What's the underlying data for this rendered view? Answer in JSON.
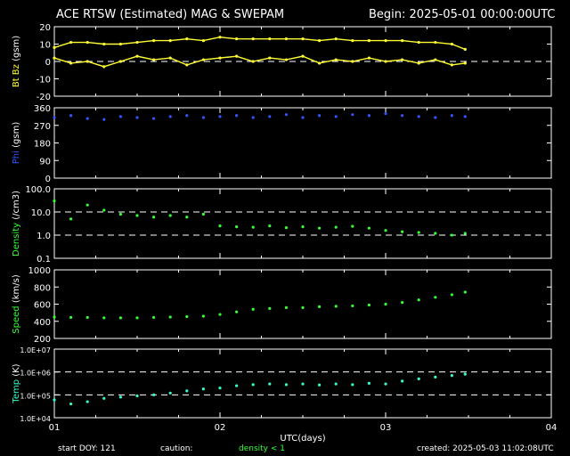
{
  "header": {
    "title": "ACE RTSW (Estimated) MAG & SWEPAM",
    "begin": "Begin: 2025-05-01 00:00:00UTC"
  },
  "footer": {
    "start_doy": "start DOY: 121",
    "caution": "caution:",
    "density_note": "density < 1",
    "created": "created: 2025-05-03 11:02:08UTC"
  },
  "colors": {
    "background": "#000000",
    "bt_bz": "#ffff33",
    "phi": "#3355ff",
    "density": "#33ff33",
    "speed": "#33ff33",
    "temp": "#33ffcc",
    "axes": "#ffffff"
  },
  "chart_data": [
    {
      "type": "line",
      "title": "ACE RTSW (Estimated) MAG & SWEPAM",
      "ylabel_parts": [
        {
          "text": "Bt",
          "color": "#ffff33"
        },
        {
          "text": " Bz",
          "color": "#ffff33"
        },
        {
          "text": " (gsm)",
          "color": "#ffffff"
        }
      ],
      "ylim": [
        -20,
        20
      ],
      "yticks": [
        "20",
        "10",
        "0",
        "-10",
        "-20"
      ],
      "ytick_values": [
        20,
        10,
        0,
        -10,
        -20
      ],
      "dashed_lines": [
        0
      ],
      "xlim": [
        1,
        4
      ],
      "series": [
        {
          "name": "Bt",
          "color": "#ffff33",
          "x": [
            1.0,
            1.1,
            1.2,
            1.3,
            1.4,
            1.5,
            1.6,
            1.7,
            1.8,
            1.9,
            2.0,
            2.1,
            2.2,
            2.3,
            2.4,
            2.5,
            2.6,
            2.7,
            2.8,
            2.9,
            3.0,
            3.1,
            3.2,
            3.3,
            3.4,
            3.48
          ],
          "y": [
            8,
            11,
            11,
            10,
            10,
            11,
            12,
            12,
            13,
            12,
            14,
            13,
            13,
            13,
            13,
            13,
            12,
            13,
            12,
            12,
            12,
            12,
            11,
            11,
            10,
            7
          ]
        },
        {
          "name": "Bz",
          "color": "#ffff33",
          "x": [
            1.0,
            1.1,
            1.2,
            1.3,
            1.4,
            1.5,
            1.6,
            1.7,
            1.8,
            1.9,
            2.0,
            2.1,
            2.2,
            2.3,
            2.4,
            2.5,
            2.6,
            2.7,
            2.8,
            2.9,
            3.0,
            3.1,
            3.2,
            3.3,
            3.4,
            3.48
          ],
          "y": [
            2,
            -1,
            0,
            -3,
            0,
            3,
            1,
            2,
            -2,
            1,
            2,
            3,
            0,
            2,
            1,
            3,
            -1,
            1,
            0,
            2,
            0,
            1,
            -1,
            1,
            -2,
            -1
          ]
        }
      ]
    },
    {
      "type": "scatter",
      "ylabel_parts": [
        {
          "text": "Phi",
          "color": "#3355ff"
        },
        {
          "text": " (gsm)",
          "color": "#ffffff"
        }
      ],
      "ylim": [
        0,
        360
      ],
      "yticks": [
        "360",
        "270",
        "180",
        "90",
        "0"
      ],
      "ytick_values": [
        360,
        270,
        180,
        90,
        0
      ],
      "dashed_lines": [],
      "xlim": [
        1,
        4
      ],
      "series": [
        {
          "name": "Phi",
          "color": "#3355ff",
          "x": [
            1.0,
            1.1,
            1.2,
            1.3,
            1.4,
            1.5,
            1.6,
            1.7,
            1.8,
            1.9,
            2.0,
            2.1,
            2.2,
            2.3,
            2.4,
            2.5,
            2.6,
            2.7,
            2.8,
            2.9,
            3.0,
            3.1,
            3.2,
            3.3,
            3.4,
            3.48
          ],
          "y": [
            310,
            320,
            305,
            300,
            315,
            310,
            305,
            315,
            320,
            310,
            315,
            320,
            310,
            315,
            325,
            310,
            320,
            315,
            325,
            320,
            330,
            320,
            315,
            310,
            320,
            315
          ]
        }
      ]
    },
    {
      "type": "scatter",
      "ylabel_parts": [
        {
          "text": "Density",
          "color": "#33ff33"
        },
        {
          "text": " (/cm3)",
          "color": "#ffffff"
        }
      ],
      "scale": "log",
      "ylim": [
        0.1,
        100
      ],
      "yticks": [
        "100.0",
        "10.0",
        "1.0",
        "0.1"
      ],
      "ytick_values": [
        100,
        10,
        1,
        0.1
      ],
      "dashed_lines": [
        10,
        1
      ],
      "xlim": [
        1,
        4
      ],
      "series": [
        {
          "name": "Density",
          "color": "#33ff33",
          "x": [
            1.0,
            1.1,
            1.2,
            1.3,
            1.4,
            1.5,
            1.6,
            1.7,
            1.8,
            1.9,
            2.0,
            2.1,
            2.2,
            2.3,
            2.4,
            2.5,
            2.6,
            2.7,
            2.8,
            2.9,
            3.0,
            3.1,
            3.2,
            3.3,
            3.4,
            3.48
          ],
          "y": [
            30,
            5,
            20,
            12,
            8,
            7,
            6,
            7,
            6,
            8,
            2.5,
            2.3,
            2.2,
            2.5,
            2.1,
            2.3,
            2.0,
            2.2,
            2.4,
            2.0,
            1.6,
            1.4,
            1.3,
            1.2,
            1.0,
            1.2
          ]
        }
      ]
    },
    {
      "type": "scatter",
      "ylabel_parts": [
        {
          "text": "Speed",
          "color": "#33ff33"
        },
        {
          "text": " (km/s)",
          "color": "#ffffff"
        }
      ],
      "ylim": [
        200,
        1000
      ],
      "yticks": [
        "1000",
        "800",
        "600",
        "400",
        "200"
      ],
      "ytick_values": [
        1000,
        800,
        600,
        400,
        200
      ],
      "dashed_lines": [],
      "xlim": [
        1,
        4
      ],
      "series": [
        {
          "name": "Speed",
          "color": "#33ff33",
          "x": [
            1.0,
            1.1,
            1.2,
            1.3,
            1.4,
            1.5,
            1.6,
            1.7,
            1.8,
            1.9,
            2.0,
            2.1,
            2.2,
            2.3,
            2.4,
            2.5,
            2.6,
            2.7,
            2.8,
            2.9,
            3.0,
            3.1,
            3.2,
            3.3,
            3.4,
            3.48
          ],
          "y": [
            450,
            445,
            445,
            440,
            440,
            440,
            445,
            450,
            455,
            460,
            480,
            510,
            540,
            550,
            560,
            560,
            570,
            575,
            580,
            590,
            600,
            620,
            650,
            680,
            710,
            740
          ]
        }
      ]
    },
    {
      "type": "scatter",
      "ylabel_parts": [
        {
          "text": "Temp",
          "color": "#33ffcc"
        },
        {
          "text": " (K)",
          "color": "#ffffff"
        }
      ],
      "scale": "log",
      "ylim": [
        10000,
        10000000
      ],
      "yticks": [
        "1.0E+07",
        "1.0E+06",
        "1.0E+05",
        "1.0E+04"
      ],
      "ytick_values": [
        10000000,
        1000000,
        100000,
        10000
      ],
      "dashed_lines": [
        1000000,
        100000
      ],
      "xlim": [
        1,
        4
      ],
      "xlabel": "UTC(days)",
      "xticks": [
        "01",
        "02",
        "03",
        "04"
      ],
      "xtick_values": [
        1,
        2,
        3,
        4
      ],
      "series": [
        {
          "name": "Temp",
          "color": "#33ffcc",
          "x": [
            1.0,
            1.1,
            1.2,
            1.3,
            1.4,
            1.5,
            1.6,
            1.7,
            1.8,
            1.9,
            2.0,
            2.1,
            2.2,
            2.3,
            2.4,
            2.5,
            2.6,
            2.7,
            2.8,
            2.9,
            3.0,
            3.1,
            3.2,
            3.3,
            3.4,
            3.48
          ],
          "y": [
            60000,
            40000,
            50000,
            70000,
            80000,
            90000,
            100000,
            120000,
            150000,
            180000,
            200000,
            250000,
            280000,
            300000,
            280000,
            300000,
            270000,
            300000,
            280000,
            320000,
            300000,
            400000,
            500000,
            600000,
            700000,
            800000
          ]
        }
      ]
    }
  ]
}
